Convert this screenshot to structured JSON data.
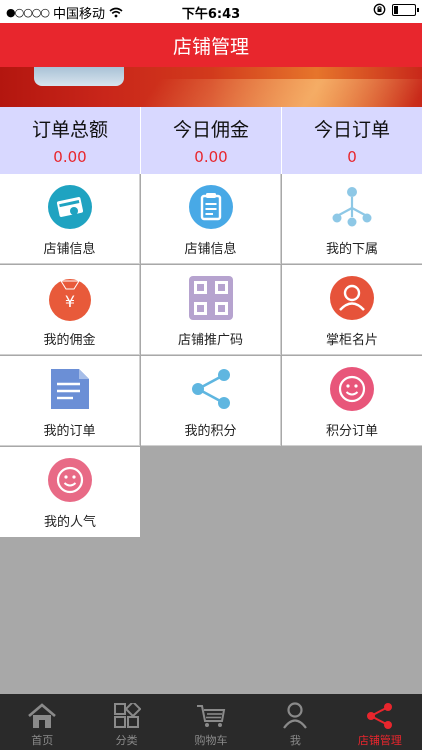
{
  "status_bar": {
    "carrier": "中国移动",
    "time": "下午6:43",
    "battery_level": 0.2
  },
  "header": {
    "title": "店铺管理"
  },
  "stats": [
    {
      "label": "订单总额",
      "value": "0.00"
    },
    {
      "label": "今日佣金",
      "value": "0.00"
    },
    {
      "label": "今日订单",
      "value": "0"
    }
  ],
  "grid": [
    {
      "label": "店铺信息",
      "icon": "money-card-icon",
      "color": "#1fa3c1"
    },
    {
      "label": "店铺信息",
      "icon": "clipboard-icon",
      "color": "#48a9e6"
    },
    {
      "label": "我的下属",
      "icon": "hierarchy-icon",
      "color": "#8ec8e6"
    },
    {
      "label": "我的佣金",
      "icon": "money-bag-icon",
      "color": "#e85a3a"
    },
    {
      "label": "店铺推广码",
      "icon": "qr-code-icon",
      "color": "#b6a3cf"
    },
    {
      "label": "掌柜名片",
      "icon": "user-card-icon",
      "color": "#e6533a"
    },
    {
      "label": "我的订单",
      "icon": "document-icon",
      "color": "#6b8fd6"
    },
    {
      "label": "我的积分",
      "icon": "share-icon",
      "color": "#5fb6e0"
    },
    {
      "label": "积分订单",
      "icon": "smile-badge-icon",
      "color": "#e8567a"
    },
    {
      "label": "我的人气",
      "icon": "smile-badge-icon",
      "color": "#e86a86"
    }
  ],
  "tabbar": [
    {
      "label": "首页",
      "icon": "home-icon"
    },
    {
      "label": "分类",
      "icon": "category-icon"
    },
    {
      "label": "购物车",
      "icon": "cart-icon"
    },
    {
      "label": "我",
      "icon": "person-icon"
    },
    {
      "label": "店铺管理",
      "icon": "share-icon",
      "active": true
    }
  ],
  "colors": {
    "brand": "#e8262d",
    "stats_bg": "#d8d8ff",
    "tabbar_bg": "#2a2a2a"
  }
}
